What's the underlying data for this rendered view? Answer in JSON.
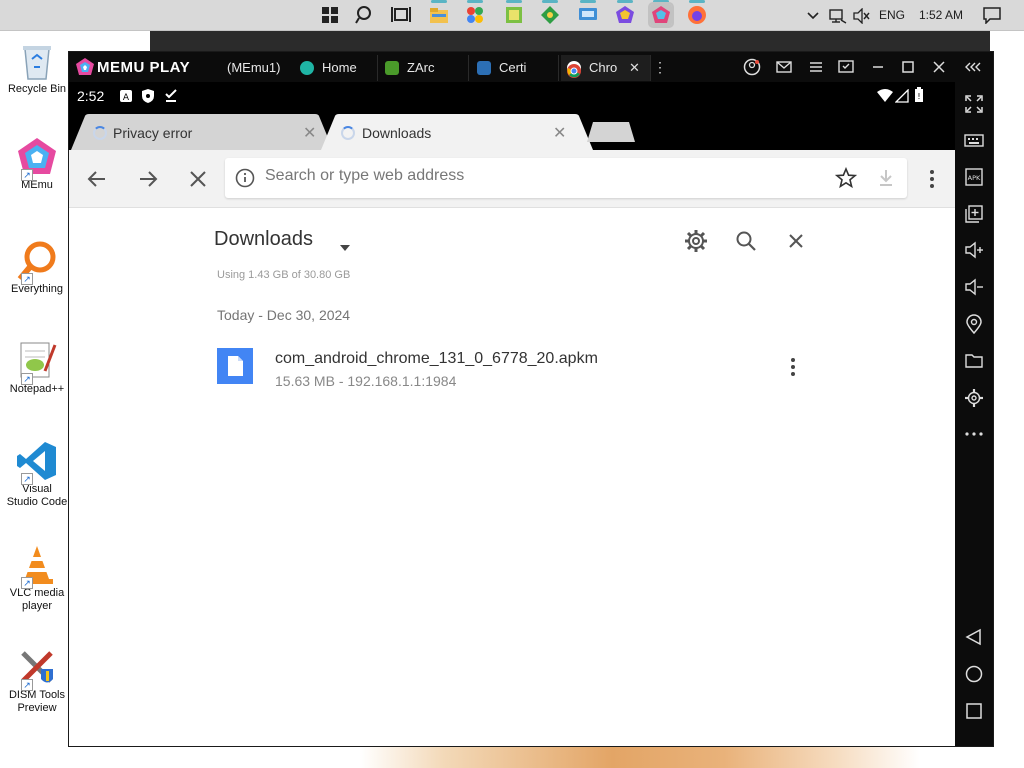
{
  "taskbar": {
    "apps": [
      {
        "name": "start-icon"
      },
      {
        "name": "search-icon"
      },
      {
        "name": "task-view-icon"
      },
      {
        "name": "file-explorer-icon"
      },
      {
        "name": "app-icon-colorful"
      },
      {
        "name": "notepad-plus-icon"
      },
      {
        "name": "green-tool-icon"
      },
      {
        "name": "remote-desktop-icon"
      },
      {
        "name": "memu-icon"
      },
      {
        "name": "memu-multi-icon"
      },
      {
        "name": "firefox-icon"
      }
    ],
    "tray": {
      "language": "ENG",
      "time": "1:52 AM"
    }
  },
  "desktop": {
    "icons": [
      {
        "label": "Recycle Bin",
        "icon": "recycle-bin-icon"
      },
      {
        "label": "MEmu",
        "icon": "memu-icon"
      },
      {
        "label": "Everything",
        "icon": "everything-search-icon"
      },
      {
        "label": "Notepad++",
        "icon": "notepad-plus-plus-icon"
      },
      {
        "label": "Visual Studio Code",
        "icon": "vscode-icon"
      },
      {
        "label": "VLC media player",
        "icon": "vlc-icon"
      },
      {
        "label": "DISM Tools Preview",
        "icon": "dism-tools-icon"
      }
    ]
  },
  "memu": {
    "brand": "MEMU PLAY",
    "instance": "(MEmu1)",
    "tabs": [
      {
        "label": "Home",
        "color": "#1fb5a5"
      },
      {
        "label": "ZArc",
        "color": "#4a9a2a"
      },
      {
        "label": "Certi",
        "color": "#2c6fb5"
      },
      {
        "label": "Chro",
        "color": "#ffffff",
        "active": true
      }
    ],
    "side_icons": [
      "fullscreen-icon",
      "keyboard-icon",
      "apk-icon",
      "add-window-icon",
      "volume-up-icon",
      "volume-down-icon",
      "location-icon",
      "folder-icon",
      "settings-icon",
      "more-icon",
      "back-icon",
      "home-icon",
      "recents-icon"
    ]
  },
  "android": {
    "status_time": "2:52"
  },
  "chrome": {
    "tabs": [
      {
        "title": "Privacy error"
      },
      {
        "title": "Downloads"
      }
    ],
    "omnibox_placeholder": "Search or type web address"
  },
  "downloads": {
    "title": "Downloads",
    "usage": "Using 1.43 GB of 30.80 GB",
    "date_header": "Today - Dec 30, 2024",
    "items": [
      {
        "name": "com_android_chrome_131_0_6778_20.apkm",
        "meta": "15.63 MB - 192.168.1.1:1984"
      }
    ]
  }
}
